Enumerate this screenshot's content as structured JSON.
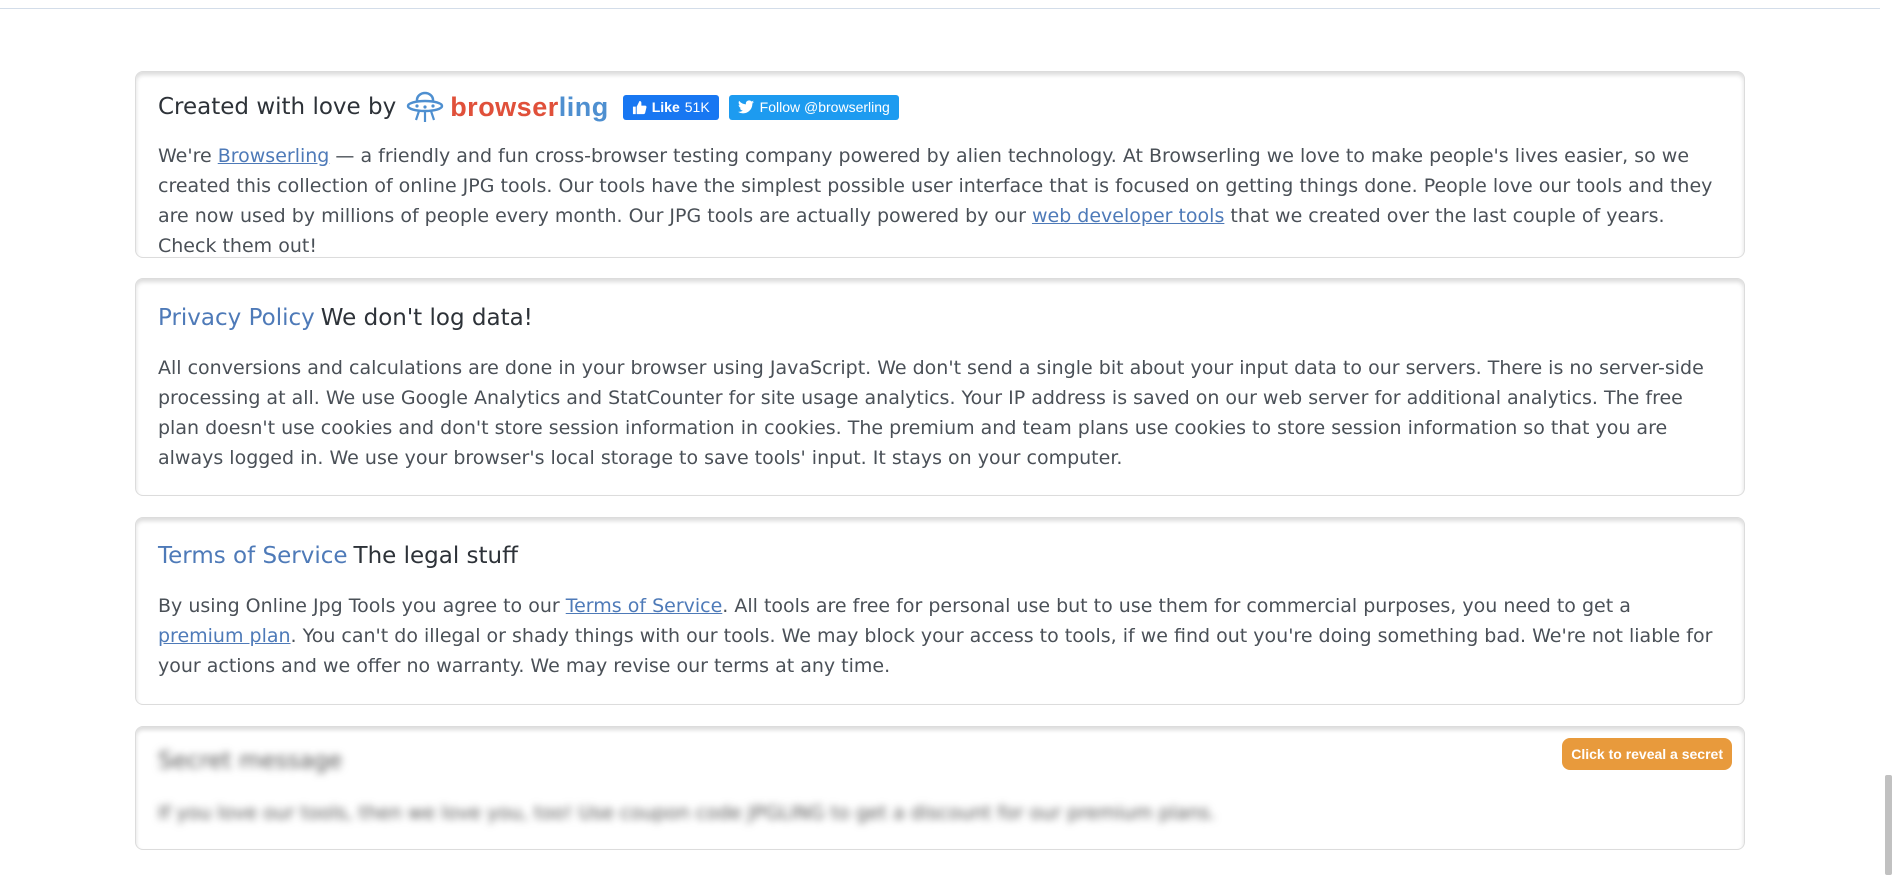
{
  "about": {
    "title_prefix": "Created with love by",
    "logo": {
      "part1": "browser",
      "part2": "ling",
      "icon": "ufo-icon"
    },
    "facebook": {
      "label": "Like",
      "count": "51K",
      "icon": "thumbs-up-icon"
    },
    "twitter": {
      "label": "Follow @browserling",
      "icon": "twitter-bird-icon"
    },
    "body_1": "We're ",
    "link_1": "Browserling",
    "body_2": " — a friendly and fun cross-browser testing company powered by alien technology. At Browserling we love to make people's lives easier, so we created this collection of online JPG tools. Our tools have the simplest possible user interface that is focused on getting things done. People love our tools and they are now used by millions of people every month. Our JPG tools are actually powered by our ",
    "link_2": "web developer tools",
    "body_3": " that we created over the last couple of years. Check them out!"
  },
  "privacy": {
    "title_link": "Privacy Policy",
    "title_rest": "We don't log data!",
    "body": "All conversions and calculations are done in your browser using JavaScript. We don't send a single bit about your input data to our servers. There is no server-side processing at all. We use Google Analytics and StatCounter for site usage analytics. Your IP address is saved on our web server for additional analytics. The free plan doesn't use cookies and don't store session information in cookies. The premium and team plans use cookies to store session information so that you are always logged in. We use your browser's local storage to save tools' input. It stays on your computer."
  },
  "terms": {
    "title_link": "Terms of Service",
    "title_rest": "The legal stuff",
    "body_1": "By using Online Jpg Tools you agree to our ",
    "link_1": "Terms of Service",
    "body_2": ". All tools are free for personal use but to use them for commercial purposes, you need to get a ",
    "link_2": "premium plan",
    "body_3": ". You can't do illegal or shady things with our tools. We may block your access to tools, if we find out you're doing something bad. We're not liable for your actions and we offer no warranty. We may revise our terms at any time."
  },
  "secret": {
    "title": "Secret message",
    "body": "If you love our tools, then we love you, too! Use coupon code JPGLING to get a discount for our premium plans.",
    "reveal_label": "Click to reveal a secret"
  },
  "colors": {
    "link": "#4e7ab8",
    "logo_red": "#e0503a",
    "logo_blue": "#4e8fd0",
    "facebook": "#1877f2",
    "twitter": "#1d9bf0",
    "reveal": "#e89a3c"
  }
}
